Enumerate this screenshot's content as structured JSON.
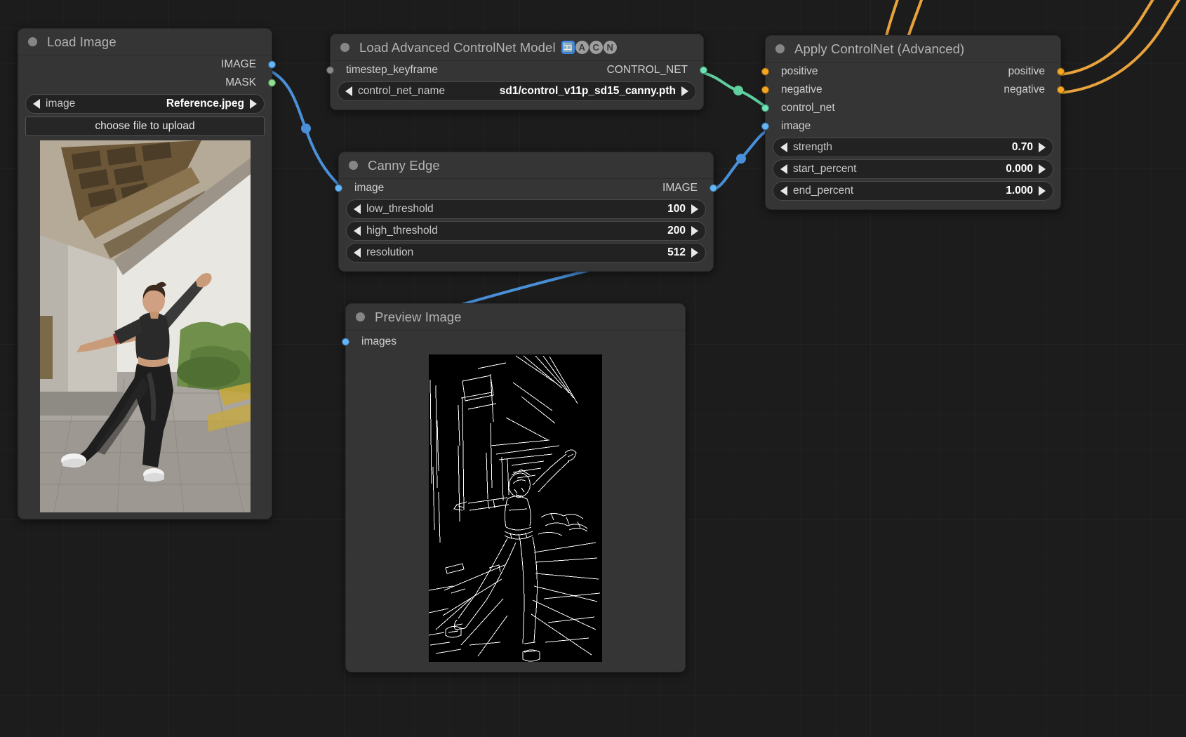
{
  "canvas": {
    "background_color": "#1c1c1c",
    "grid": true
  },
  "colors": {
    "node_bg": "#353535",
    "title_text": "#b3b3b3",
    "slot_image": "#64b5f6",
    "slot_mask": "#8fdf8f",
    "slot_controlnet": "#6ee3b4",
    "slot_conditioning": "#f5a623",
    "wire_image": "#4a90d9",
    "wire_controlnet": "#5fcf9e",
    "wire_conditioning": "#e8a33d"
  },
  "nodes": {
    "load_image": {
      "title": "Load Image",
      "outputs": [
        {
          "label": "IMAGE",
          "color_key": "slot_image"
        },
        {
          "label": "MASK",
          "color_key": "slot_mask"
        }
      ],
      "widgets": [
        {
          "name": "image",
          "value": "Reference.jpeg",
          "type": "combo"
        }
      ],
      "button": "choose file to upload",
      "preview_alt": "Reference photo of a dancer posing under a concrete building overhang"
    },
    "load_controlnet": {
      "title": "Load Advanced ControlNet Model",
      "badges": [
        "🈁",
        "A",
        "C",
        "N"
      ],
      "inputs": [
        {
          "label": "timestep_keyframe",
          "color_key": "slot_gray"
        }
      ],
      "outputs": [
        {
          "label": "CONTROL_NET",
          "color_key": "slot_controlnet"
        }
      ],
      "widgets": [
        {
          "name": "control_net_name",
          "value": "sd1/control_v11p_sd15_canny.pth",
          "type": "combo"
        }
      ]
    },
    "canny_edge": {
      "title": "Canny Edge",
      "inputs": [
        {
          "label": "image",
          "color_key": "slot_image"
        }
      ],
      "outputs": [
        {
          "label": "IMAGE",
          "color_key": "slot_image"
        }
      ],
      "widgets": [
        {
          "name": "low_threshold",
          "value": "100",
          "type": "number"
        },
        {
          "name": "high_threshold",
          "value": "200",
          "type": "number"
        },
        {
          "name": "resolution",
          "value": "512",
          "type": "number"
        }
      ]
    },
    "apply_controlnet": {
      "title": "Apply ControlNet (Advanced)",
      "inputs": [
        {
          "label": "positive",
          "color_key": "slot_conditioning"
        },
        {
          "label": "negative",
          "color_key": "slot_conditioning"
        },
        {
          "label": "control_net",
          "color_key": "slot_controlnet"
        },
        {
          "label": "image",
          "color_key": "slot_image"
        }
      ],
      "outputs": [
        {
          "label": "positive",
          "color_key": "slot_conditioning"
        },
        {
          "label": "negative",
          "color_key": "slot_conditioning"
        }
      ],
      "widgets": [
        {
          "name": "strength",
          "value": "0.70",
          "type": "number"
        },
        {
          "name": "start_percent",
          "value": "0.000",
          "type": "number"
        },
        {
          "name": "end_percent",
          "value": "1.000",
          "type": "number"
        }
      ]
    },
    "preview_image": {
      "title": "Preview Image",
      "inputs": [
        {
          "label": "images",
          "color_key": "slot_image"
        }
      ],
      "preview_alt": "Canny edge detection result: white outlines on black background"
    }
  }
}
